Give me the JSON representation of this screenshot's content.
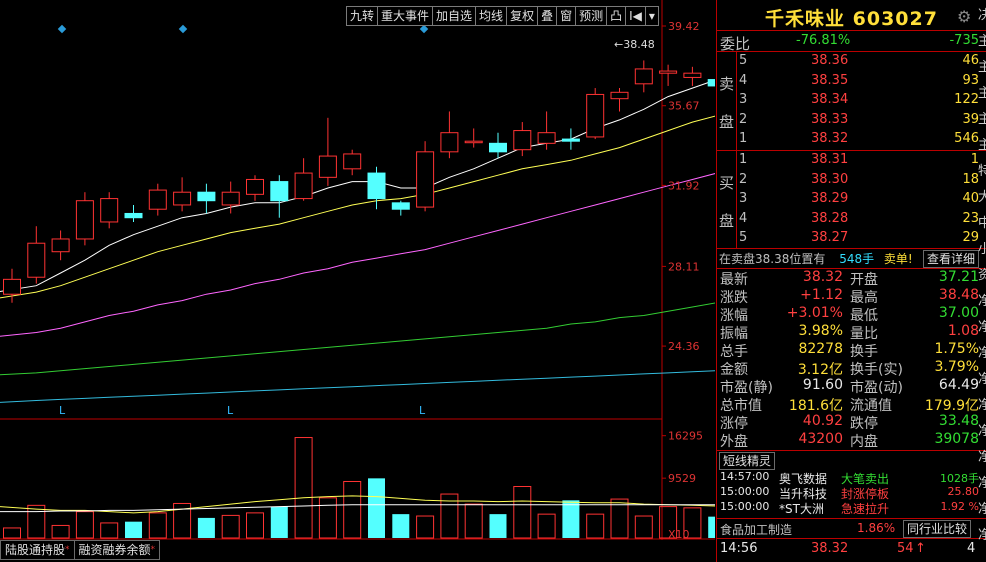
{
  "toolbar": {
    "buttons": [
      "九转",
      "重大事件",
      "加自选",
      "均线",
      "复权",
      "叠",
      "窗",
      "预测",
      "凸",
      "I◀",
      "▾"
    ]
  },
  "chart_data": {
    "type": "candlestick",
    "y_axis": {
      "ticks": [
        "39.42",
        "35.67",
        "31.92",
        "28.11",
        "24.36"
      ],
      "ylim": [
        20.6,
        39.42
      ]
    },
    "high_marker": "38.48",
    "low_markers": [
      "L",
      "L",
      "L"
    ],
    "candles": [
      {
        "o": 26.8,
        "c": 27.5,
        "h": 28.0,
        "l": 26.4
      },
      {
        "o": 27.6,
        "c": 29.2,
        "h": 30.0,
        "l": 27.3
      },
      {
        "o": 28.8,
        "c": 29.4,
        "h": 29.8,
        "l": 28.4
      },
      {
        "o": 29.4,
        "c": 31.2,
        "h": 31.6,
        "l": 29.1
      },
      {
        "o": 30.2,
        "c": 31.3,
        "h": 31.6,
        "l": 29.9
      },
      {
        "o": 30.6,
        "c": 30.4,
        "h": 31.0,
        "l": 30.2
      },
      {
        "o": 30.8,
        "c": 31.7,
        "h": 32.0,
        "l": 30.5
      },
      {
        "o": 31.0,
        "c": 31.6,
        "h": 32.3,
        "l": 30.7
      },
      {
        "o": 31.6,
        "c": 31.2,
        "h": 32.0,
        "l": 30.6
      },
      {
        "o": 31.0,
        "c": 31.6,
        "h": 32.1,
        "l": 30.6
      },
      {
        "o": 31.5,
        "c": 32.2,
        "h": 32.4,
        "l": 31.2
      },
      {
        "o": 32.1,
        "c": 31.2,
        "h": 32.4,
        "l": 30.4
      },
      {
        "o": 31.3,
        "c": 32.5,
        "h": 33.2,
        "l": 31.2
      },
      {
        "o": 32.3,
        "c": 33.3,
        "h": 35.1,
        "l": 31.9
      },
      {
        "o": 32.7,
        "c": 33.4,
        "h": 33.6,
        "l": 32.4
      },
      {
        "o": 32.5,
        "c": 31.3,
        "h": 32.8,
        "l": 30.8
      },
      {
        "o": 31.1,
        "c": 30.8,
        "h": 31.2,
        "l": 30.5
      },
      {
        "o": 30.9,
        "c": 33.5,
        "h": 34.0,
        "l": 30.7
      },
      {
        "o": 33.5,
        "c": 34.4,
        "h": 35.4,
        "l": 33.2
      },
      {
        "o": 34.0,
        "c": 34.0,
        "h": 34.6,
        "l": 33.7
      },
      {
        "o": 33.9,
        "c": 33.5,
        "h": 34.4,
        "l": 33.2
      },
      {
        "o": 33.6,
        "c": 34.5,
        "h": 34.9,
        "l": 33.3
      },
      {
        "o": 33.9,
        "c": 34.4,
        "h": 35.4,
        "l": 33.6
      },
      {
        "o": 34.1,
        "c": 34.0,
        "h": 34.6,
        "l": 33.6
      },
      {
        "o": 34.2,
        "c": 36.2,
        "h": 36.5,
        "l": 34.1
      },
      {
        "o": 36.0,
        "c": 36.3,
        "h": 36.5,
        "l": 35.4
      },
      {
        "o": 36.7,
        "c": 37.4,
        "h": 37.8,
        "l": 36.3
      },
      {
        "o": 37.2,
        "c": 37.3,
        "h": 37.6,
        "l": 36.6
      },
      {
        "o": 37.0,
        "c": 37.2,
        "h": 37.5,
        "l": 36.6
      },
      {
        "o": 36.9,
        "c": 36.6,
        "h": 37.3,
        "l": 36.2
      },
      {
        "o": 35.9,
        "c": 35.7,
        "h": 36.4,
        "l": 35.6
      },
      {
        "o": 35.7,
        "c": 35.7,
        "h": 36.9,
        "l": 35.3
      },
      {
        "o": 35.8,
        "c": 35.9,
        "h": 37.5,
        "l": 35.2
      },
      {
        "o": 37.2,
        "c": 38.32,
        "h": 38.48,
        "l": 37.0
      }
    ],
    "ma_lines": {
      "ma5": [
        26.9,
        27.2,
        27.8,
        28.4,
        29.1,
        29.6,
        30.0,
        30.4,
        30.6,
        30.9,
        31.1,
        31.1,
        31.4,
        31.8,
        32.1,
        32.1,
        31.8,
        31.8,
        32.3,
        32.7,
        33.2,
        33.7,
        33.9,
        34.1,
        34.6,
        35.0,
        35.5,
        36.1,
        36.5,
        36.9,
        37.0,
        36.8,
        36.6,
        36.8
      ],
      "ma10": [
        26.6,
        26.9,
        27.2,
        27.6,
        28.0,
        28.4,
        28.8,
        29.1,
        29.4,
        29.7,
        29.9,
        30.1,
        30.4,
        30.7,
        31.0,
        31.2,
        31.3,
        31.5,
        31.8,
        32.1,
        32.4,
        32.7,
        32.9,
        33.1,
        33.4,
        33.7,
        34.1,
        34.5,
        34.9,
        35.2,
        35.5,
        35.7,
        35.9,
        36.2
      ],
      "ma20": [
        24.8,
        25.0,
        25.2,
        25.5,
        25.8,
        26.0,
        26.3,
        26.5,
        26.8,
        27.0,
        27.3,
        27.5,
        27.8,
        28.0,
        28.3,
        28.5,
        28.7,
        28.9,
        29.2,
        29.5,
        29.8,
        30.1,
        30.4,
        30.7,
        31.0,
        31.3,
        31.6,
        31.9,
        32.2,
        32.5,
        32.8,
        33.1,
        33.4,
        33.7
      ],
      "ma60": [
        23.0,
        23.1,
        23.2,
        23.3,
        23.4,
        23.5,
        23.6,
        23.7,
        23.8,
        23.9,
        24.0,
        24.1,
        24.2,
        24.3,
        24.4,
        24.5,
        24.6,
        24.7,
        24.8,
        24.9,
        25.0,
        25.1,
        25.2,
        25.4,
        25.5,
        25.7,
        25.8,
        26.0,
        26.2,
        26.4,
        26.6,
        26.8,
        27.0,
        27.3
      ],
      "ma120": [
        21.7,
        21.8,
        21.85,
        21.9,
        21.95,
        22.0,
        22.05,
        22.1,
        22.15,
        22.2,
        22.25,
        22.3,
        22.35,
        22.4,
        22.45,
        22.5,
        22.55,
        22.6,
        22.65,
        22.7,
        22.75,
        22.8,
        22.85,
        22.9,
        22.95,
        23.0,
        23.05,
        23.1,
        23.15,
        23.2,
        23.25,
        23.3,
        23.35,
        23.4
      ]
    },
    "volume": {
      "ticks": [
        "16295",
        "9529",
        "X10"
      ],
      "ylim": [
        0,
        17200
      ],
      "values": [
        1600,
        5200,
        2000,
        4200,
        2400,
        2600,
        4000,
        5500,
        3200,
        3600,
        4000,
        5000,
        16000,
        6400,
        9000,
        9500,
        3800,
        3500,
        7000,
        5400,
        3800,
        8200,
        3800,
        6000,
        3800,
        6200,
        3500,
        5000,
        4800,
        3400,
        6000,
        6200,
        5200,
        7000
      ]
    },
    "volume_ma": [
      5000,
      4600,
      4400,
      4400,
      4200,
      4000,
      4200,
      4600,
      5000,
      5400,
      5800,
      6100,
      6400,
      6600,
      6700,
      6600,
      6300,
      6000,
      5900,
      5900,
      5800,
      5900,
      5800,
      5700,
      5600,
      5600,
      5400,
      5300,
      5200,
      5100,
      5200,
      5300,
      5400,
      5600
    ],
    "volume_ma2": [
      4200,
      4200,
      4300,
      4300,
      4400,
      4400,
      4500,
      4600,
      4700,
      4800,
      4900,
      5000,
      5100,
      5200,
      5300,
      5300,
      5300,
      5300,
      5300,
      5300,
      5300,
      5300,
      5300,
      5300,
      5300,
      5300,
      5300,
      5300,
      5300,
      5300,
      5300,
      5300,
      5300,
      5300
    ]
  },
  "bottom_tabs": [
    {
      "label": "陆股通持股",
      "star": "*"
    },
    {
      "label": "融资融券余额",
      "star": "*"
    }
  ],
  "stock": {
    "name": "千禾味业",
    "code": "603027"
  },
  "weibi": {
    "label": "委比",
    "pct": "-76.81%",
    "diff": "-735"
  },
  "sell_label": [
    "卖",
    "盘"
  ],
  "buy_label": [
    "买",
    "盘"
  ],
  "sell": [
    {
      "n": "5",
      "price": "38.36",
      "vol": "46"
    },
    {
      "n": "4",
      "price": "38.35",
      "vol": "93"
    },
    {
      "n": "3",
      "price": "38.34",
      "vol": "122"
    },
    {
      "n": "2",
      "price": "38.33",
      "vol": "39"
    },
    {
      "n": "1",
      "price": "38.32",
      "vol": "546"
    }
  ],
  "buy": [
    {
      "n": "1",
      "price": "38.31",
      "vol": "1"
    },
    {
      "n": "2",
      "price": "38.30",
      "vol": "18"
    },
    {
      "n": "3",
      "price": "38.29",
      "vol": "40"
    },
    {
      "n": "4",
      "price": "38.28",
      "vol": "23"
    },
    {
      "n": "5",
      "price": "38.27",
      "vol": "29"
    }
  ],
  "notice": {
    "text": "在卖盘38.38位置有",
    "vol": "548手",
    "action": "卖单!",
    "detail_btn": "查看详细"
  },
  "quote": [
    {
      "l1": "最新",
      "v1": "38.32",
      "c1": "red",
      "l2": "开盘",
      "v2": "37.21",
      "c2": "green"
    },
    {
      "l1": "涨跌",
      "v1": "+1.12",
      "c1": "red",
      "l2": "最高",
      "v2": "38.48",
      "c2": "red"
    },
    {
      "l1": "涨幅",
      "v1": "+3.01%",
      "c1": "red",
      "l2": "最低",
      "v2": "37.00",
      "c2": "green"
    },
    {
      "l1": "振幅",
      "v1": "3.98%",
      "c1": "yellow",
      "l2": "量比",
      "v2": "1.08",
      "c2": "red"
    },
    {
      "l1": "总手",
      "v1": "82278",
      "c1": "yellow",
      "l2": "换手",
      "v2": "1.75%",
      "c2": "yellow"
    },
    {
      "l1": "金额",
      "v1": "3.12亿",
      "c1": "yellow",
      "l2": "换手(实)",
      "v2": "3.79%",
      "c2": "yellow"
    },
    {
      "l1": "市盈(静)",
      "v1": "91.60",
      "c1": "white",
      "l2": "市盈(动)",
      "v2": "64.49",
      "c2": "white"
    },
    {
      "l1": "总市值",
      "v1": "181.6亿",
      "c1": "yellow",
      "l2": "流通值",
      "v2": "179.9亿",
      "c2": "yellow"
    },
    {
      "l1": "涨停",
      "v1": "40.92",
      "c1": "red",
      "l2": "跌停",
      "v2": "33.48",
      "c2": "green"
    },
    {
      "l1": "外盘",
      "v1": "43200",
      "c1": "red",
      "l2": "内盘",
      "v2": "39078",
      "c2": "green"
    }
  ],
  "sprite": {
    "title": "短线精灵",
    "rows": [
      {
        "time": "14:57:00",
        "name": "奥飞数据",
        "event": "大笔卖出",
        "value": "1028手",
        "ecolor": "green"
      },
      {
        "time": "15:00:00",
        "name": "当升科技",
        "event": "封涨停板",
        "value": "25.80",
        "ecolor": "red"
      },
      {
        "time": "15:00:00",
        "name": "*ST大洲",
        "event": "急速拉升",
        "value": "1.92 %",
        "ecolor": "red"
      }
    ]
  },
  "industry": {
    "name": "食品加工制造",
    "pct": "1.86%",
    "btn": "同行业比较"
  },
  "tick": {
    "time": "14:56",
    "price": "38.32",
    "vol": "54",
    "arrow": "↑",
    "count": "4"
  },
  "edge_chars": [
    "决",
    "主",
    "主",
    "主",
    "主",
    "主",
    "特",
    "大",
    "中",
    "小",
    "资",
    "净",
    "净",
    "净",
    "净",
    "净",
    "净",
    "净",
    "净",
    "净",
    "净"
  ]
}
